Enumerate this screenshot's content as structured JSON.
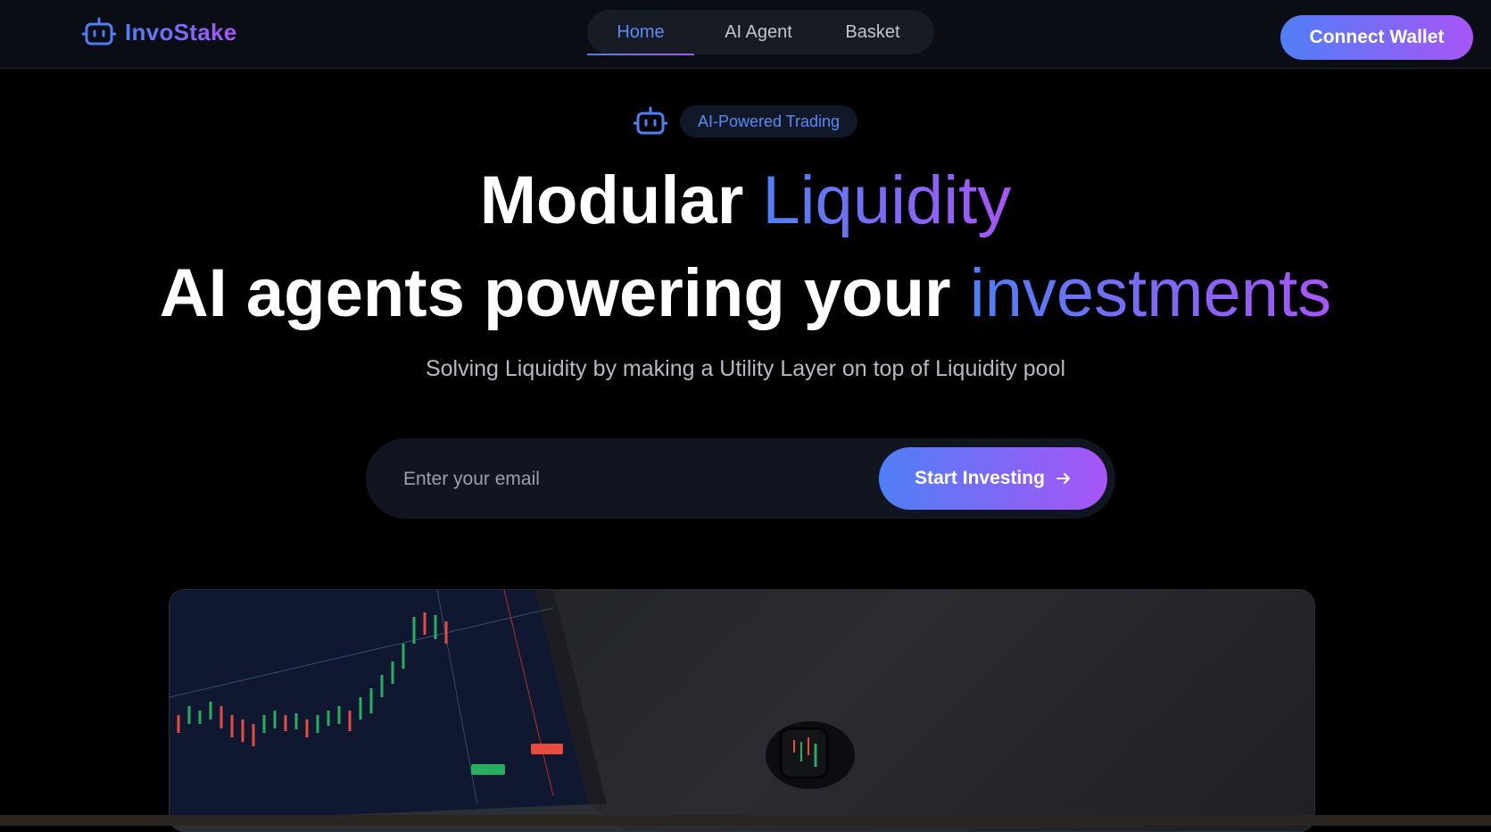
{
  "brand": {
    "name": "InvoStake"
  },
  "nav": {
    "tabs": [
      {
        "label": "Home",
        "active": true
      },
      {
        "label": "AI Agent",
        "active": false
      },
      {
        "label": "Basket",
        "active": false
      }
    ],
    "connect_label": "Connect Wallet"
  },
  "hero": {
    "badge": "AI-Powered Trading",
    "headline_line1_plain": "Modular",
    "headline_line1_accent": "Liquidity",
    "headline_line2_plain": "AI agents powering your",
    "headline_line2_accent": "investments",
    "subtitle": "Solving Liquidity by making a Utility Layer on top of Liquidity pool",
    "email_placeholder": "Enter your email",
    "cta_label": "Start Investing"
  },
  "icons": {
    "brand": "robot-icon",
    "badge": "robot-icon",
    "cta": "arrow-right-icon"
  },
  "colors": {
    "accent_start": "#4f7ff5",
    "accent_end": "#a855f7",
    "background": "#000000",
    "nav_background": "#0a0d14"
  }
}
